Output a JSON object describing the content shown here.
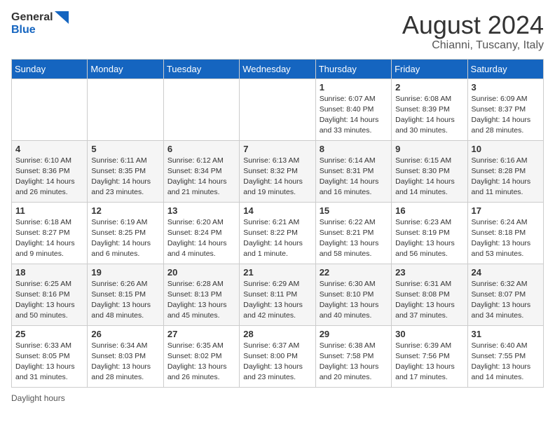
{
  "logo": {
    "text_general": "General",
    "text_blue": "Blue"
  },
  "title": "August 2024",
  "subtitle": "Chianni, Tuscany, Italy",
  "days_of_week": [
    "Sunday",
    "Monday",
    "Tuesday",
    "Wednesday",
    "Thursday",
    "Friday",
    "Saturday"
  ],
  "weeks": [
    [
      {
        "day": "",
        "info": ""
      },
      {
        "day": "",
        "info": ""
      },
      {
        "day": "",
        "info": ""
      },
      {
        "day": "",
        "info": ""
      },
      {
        "day": "1",
        "info": "Sunrise: 6:07 AM\nSunset: 8:40 PM\nDaylight: 14 hours and 33 minutes."
      },
      {
        "day": "2",
        "info": "Sunrise: 6:08 AM\nSunset: 8:39 PM\nDaylight: 14 hours and 30 minutes."
      },
      {
        "day": "3",
        "info": "Sunrise: 6:09 AM\nSunset: 8:37 PM\nDaylight: 14 hours and 28 minutes."
      }
    ],
    [
      {
        "day": "4",
        "info": "Sunrise: 6:10 AM\nSunset: 8:36 PM\nDaylight: 14 hours and 26 minutes."
      },
      {
        "day": "5",
        "info": "Sunrise: 6:11 AM\nSunset: 8:35 PM\nDaylight: 14 hours and 23 minutes."
      },
      {
        "day": "6",
        "info": "Sunrise: 6:12 AM\nSunset: 8:34 PM\nDaylight: 14 hours and 21 minutes."
      },
      {
        "day": "7",
        "info": "Sunrise: 6:13 AM\nSunset: 8:32 PM\nDaylight: 14 hours and 19 minutes."
      },
      {
        "day": "8",
        "info": "Sunrise: 6:14 AM\nSunset: 8:31 PM\nDaylight: 14 hours and 16 minutes."
      },
      {
        "day": "9",
        "info": "Sunrise: 6:15 AM\nSunset: 8:30 PM\nDaylight: 14 hours and 14 minutes."
      },
      {
        "day": "10",
        "info": "Sunrise: 6:16 AM\nSunset: 8:28 PM\nDaylight: 14 hours and 11 minutes."
      }
    ],
    [
      {
        "day": "11",
        "info": "Sunrise: 6:18 AM\nSunset: 8:27 PM\nDaylight: 14 hours and 9 minutes."
      },
      {
        "day": "12",
        "info": "Sunrise: 6:19 AM\nSunset: 8:25 PM\nDaylight: 14 hours and 6 minutes."
      },
      {
        "day": "13",
        "info": "Sunrise: 6:20 AM\nSunset: 8:24 PM\nDaylight: 14 hours and 4 minutes."
      },
      {
        "day": "14",
        "info": "Sunrise: 6:21 AM\nSunset: 8:22 PM\nDaylight: 14 hours and 1 minute."
      },
      {
        "day": "15",
        "info": "Sunrise: 6:22 AM\nSunset: 8:21 PM\nDaylight: 13 hours and 58 minutes."
      },
      {
        "day": "16",
        "info": "Sunrise: 6:23 AM\nSunset: 8:19 PM\nDaylight: 13 hours and 56 minutes."
      },
      {
        "day": "17",
        "info": "Sunrise: 6:24 AM\nSunset: 8:18 PM\nDaylight: 13 hours and 53 minutes."
      }
    ],
    [
      {
        "day": "18",
        "info": "Sunrise: 6:25 AM\nSunset: 8:16 PM\nDaylight: 13 hours and 50 minutes."
      },
      {
        "day": "19",
        "info": "Sunrise: 6:26 AM\nSunset: 8:15 PM\nDaylight: 13 hours and 48 minutes."
      },
      {
        "day": "20",
        "info": "Sunrise: 6:28 AM\nSunset: 8:13 PM\nDaylight: 13 hours and 45 minutes."
      },
      {
        "day": "21",
        "info": "Sunrise: 6:29 AM\nSunset: 8:11 PM\nDaylight: 13 hours and 42 minutes."
      },
      {
        "day": "22",
        "info": "Sunrise: 6:30 AM\nSunset: 8:10 PM\nDaylight: 13 hours and 40 minutes."
      },
      {
        "day": "23",
        "info": "Sunrise: 6:31 AM\nSunset: 8:08 PM\nDaylight: 13 hours and 37 minutes."
      },
      {
        "day": "24",
        "info": "Sunrise: 6:32 AM\nSunset: 8:07 PM\nDaylight: 13 hours and 34 minutes."
      }
    ],
    [
      {
        "day": "25",
        "info": "Sunrise: 6:33 AM\nSunset: 8:05 PM\nDaylight: 13 hours and 31 minutes."
      },
      {
        "day": "26",
        "info": "Sunrise: 6:34 AM\nSunset: 8:03 PM\nDaylight: 13 hours and 28 minutes."
      },
      {
        "day": "27",
        "info": "Sunrise: 6:35 AM\nSunset: 8:02 PM\nDaylight: 13 hours and 26 minutes."
      },
      {
        "day": "28",
        "info": "Sunrise: 6:37 AM\nSunset: 8:00 PM\nDaylight: 13 hours and 23 minutes."
      },
      {
        "day": "29",
        "info": "Sunrise: 6:38 AM\nSunset: 7:58 PM\nDaylight: 13 hours and 20 minutes."
      },
      {
        "day": "30",
        "info": "Sunrise: 6:39 AM\nSunset: 7:56 PM\nDaylight: 13 hours and 17 minutes."
      },
      {
        "day": "31",
        "info": "Sunrise: 6:40 AM\nSunset: 7:55 PM\nDaylight: 13 hours and 14 minutes."
      }
    ]
  ],
  "footer": "Daylight hours"
}
